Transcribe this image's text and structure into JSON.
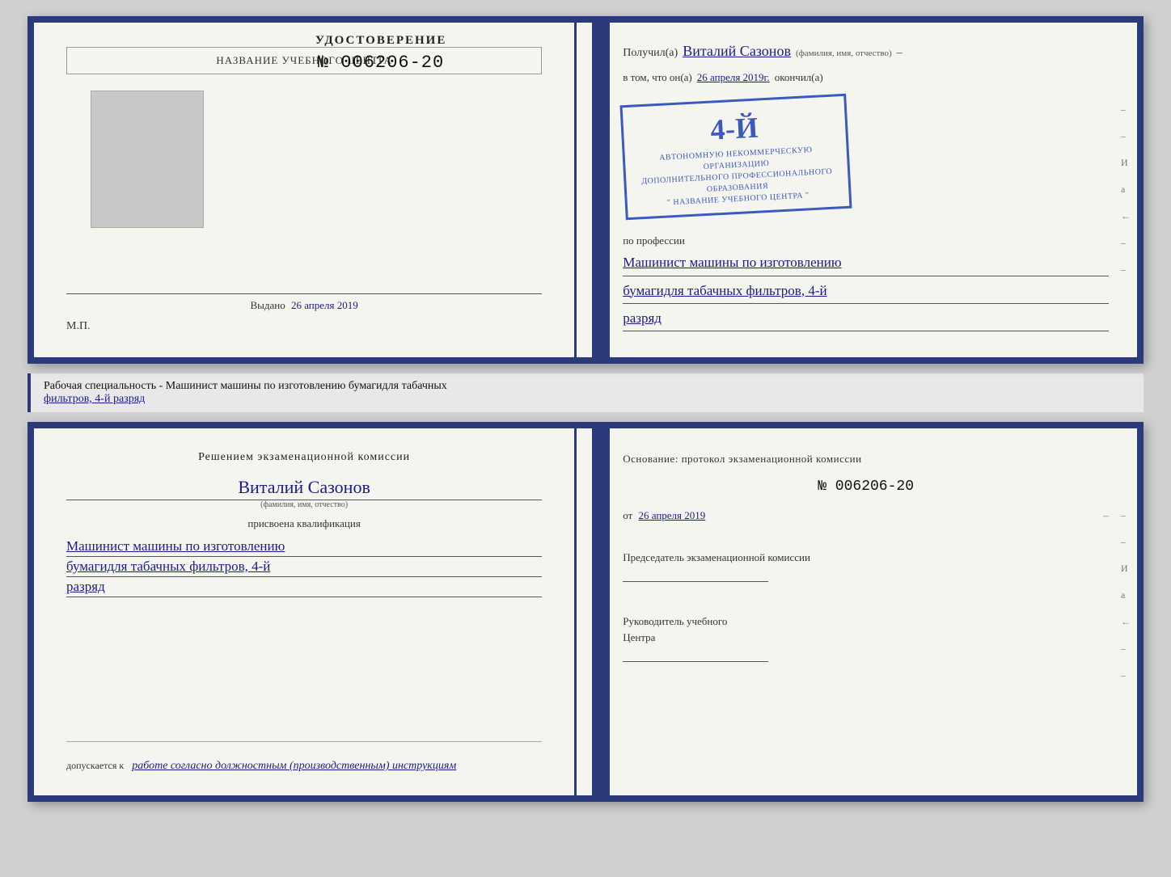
{
  "top_cert": {
    "left": {
      "header": "НАЗВАНИЕ УЧЕБНОГО ЦЕНТРА",
      "cert_title": "УДОСТОВЕРЕНИЕ",
      "cert_number": "№ 006206-20",
      "issued_label": "Выдано",
      "issued_date": "26 апреля 2019",
      "mp": "М.П."
    },
    "right": {
      "received_prefix": "Получил(а)",
      "recipient_name": "Виталий Сазонов",
      "recipient_sublabel": "(фамилия, имя, отчество)",
      "body_prefix": "в том, что он(а)",
      "date_handwritten": "26 апреля 2019г.",
      "finished_label": "окончил(а)",
      "stamp_num": "4-й",
      "stamp_line1": "АВТОНОМНУЮ НЕКОММЕРЧЕСКУЮ ОРГАНИЗАЦИЮ",
      "stamp_line2": "ДОПОЛНИТЕЛЬНОГО ПРОФЕССИОНАЛЬНОГО ОБРАЗОВАНИЯ",
      "stamp_line3": "\" НАЗВАНИЕ УЧЕБНОГО ЦЕНТРА \"",
      "profession_prefix": "по профессии",
      "profession_line1": "Машинист машины по изготовлению",
      "profession_line2": "бумагидля табачных фильтров, 4-й",
      "profession_line3": "разряд"
    }
  },
  "separator": {
    "text_before": "Рабочая специальность - Машинист машины по изготовлению бумагидля табачных",
    "text_underlined": "фильтров, 4-й разряд"
  },
  "bottom_cert": {
    "left": {
      "decision_title": "Решением экзаменационной комиссии",
      "name_handwritten": "Виталий Сазонов",
      "name_sublabel": "(фамилия, имя, отчество)",
      "assigned_label": "присвоена квалификация",
      "qual_line1": "Машинист машины по изготовлению",
      "qual_line2": "бумагидля табачных фильтров, 4-й",
      "qual_line3": "разряд",
      "allowed_prefix": "допускается к",
      "allowed_text": "работе согласно должностным (производственным) инструкциям"
    },
    "right": {
      "basis_label": "Основание: протокол экзаменационной комиссии",
      "protocol_number": "№ 006206-20",
      "date_prefix": "от",
      "date_value": "26 апреля 2019",
      "chairman_label": "Председатель экзаменационной комиссии",
      "head_label1": "Руководитель учебного",
      "head_label2": "Центра"
    },
    "deco": {
      "letters": [
        "И",
        "а",
        "←",
        "–",
        "–",
        "–",
        "–"
      ]
    }
  }
}
